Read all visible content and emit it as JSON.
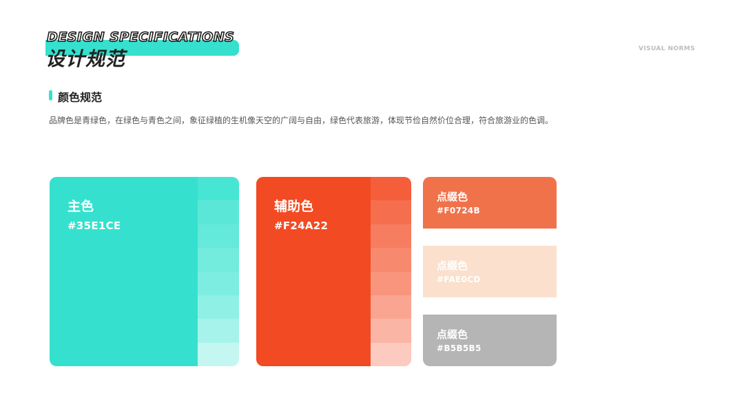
{
  "header": {
    "title_en": "DESIGN SPECIFICATIONS",
    "title_cn": "设计规范",
    "tag": "VISUAL NORMS"
  },
  "section": {
    "title": "颜色规范",
    "description": "品牌色是青绿色，在绿色与青色之间，象征绿植的生机像天空的广阔与自由，绿色代表旅游，体现节俭自然价位合理，符合旅游业的色调。"
  },
  "primary": {
    "name": "主色",
    "hex": "#35E1CE",
    "tints": [
      "#47E5D3",
      "#5BE7D7",
      "#64E9DA",
      "#73EBDD",
      "#7DEDE1",
      "#8FF0E6",
      "#A6F3EB",
      "#C4F7F1"
    ]
  },
  "secondary": {
    "name": "辅助色",
    "hex": "#F24A22",
    "tints": [
      "#F45E3A",
      "#F56F4F",
      "#F67D5F",
      "#F78A6E",
      "#F8957C",
      "#F9A591",
      "#FAB5A4",
      "#FCCABE"
    ]
  },
  "accents": [
    {
      "name": "点缀色",
      "hex": "#F0724B",
      "color": "#F0724B"
    },
    {
      "name": "点缀色",
      "hex": "#FAE0CD",
      "color": "#FAE0CD"
    },
    {
      "name": "点缀色",
      "hex": "#B5B5B5",
      "color": "#B5B5B5"
    }
  ]
}
